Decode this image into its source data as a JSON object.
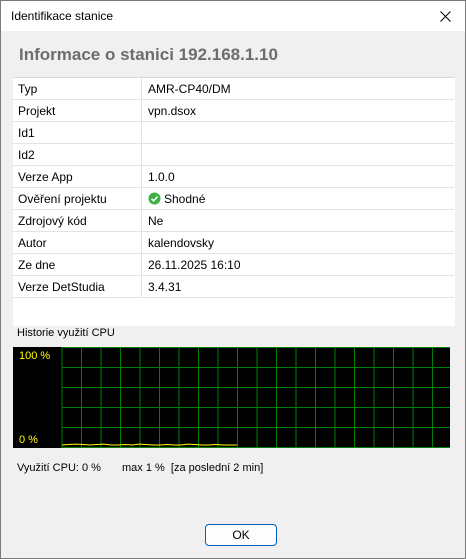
{
  "window": {
    "title": "Identifikace stanice"
  },
  "heading": "Informace o stanici 192.168.1.10",
  "info_rows": [
    {
      "key": "Typ",
      "value": "AMR-CP40/DM"
    },
    {
      "key": "Projekt",
      "value": "vpn.dsox"
    },
    {
      "key": "Id1",
      "value": ""
    },
    {
      "key": "Id2",
      "value": ""
    },
    {
      "key": "Verze App",
      "value": "1.0.0"
    },
    {
      "key": "Ověření projektu",
      "value": "Shodné",
      "icon": "check-circle-icon",
      "icon_color": "#3cb043"
    },
    {
      "key": "Zdrojový kód",
      "value": "Ne"
    },
    {
      "key": "Autor",
      "value": "kalendovsky"
    },
    {
      "key": "Ze dne",
      "value": "26.11.2025 16:10"
    },
    {
      "key": "Verze DetStudia",
      "value": "3.4.31"
    }
  ],
  "cpu": {
    "section_label": "Historie využití CPU",
    "max_label": "100 %",
    "min_label": "0 %",
    "usage_text": "Využití CPU: 0 %",
    "max_text": "max 1 %  [za poslední 2 min]",
    "history": [
      0,
      0.5,
      1,
      0.5,
      0,
      0.5,
      1,
      0,
      0,
      0.5,
      0,
      1,
      0.5,
      0,
      0,
      0.5,
      0,
      0,
      1,
      0.5,
      0,
      0,
      0.5,
      0,
      0,
      0
    ]
  },
  "colors": {
    "graph_background": "#000000",
    "graph_grid": "#008000",
    "graph_line": "#ffff00",
    "ok_border": "#005fb8"
  },
  "buttons": {
    "ok": "OK"
  }
}
